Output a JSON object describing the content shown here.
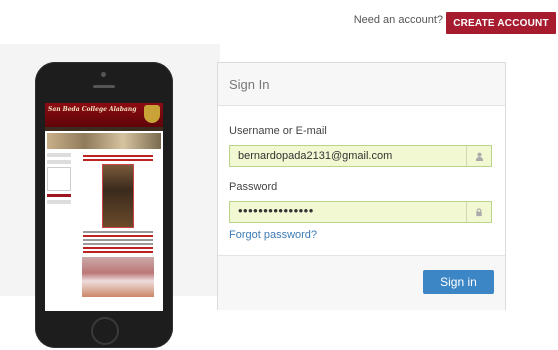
{
  "header": {
    "prompt": "Need an account?",
    "create_account": "CREATE ACCOUNT",
    "accent": "#a61c2e"
  },
  "phone_preview": {
    "site_title": "San Beda College Alabang",
    "screen_description_hidden": ""
  },
  "signin": {
    "title": "Sign In",
    "username_label": "Username or E-mail",
    "username_value": "bernardopada2131@gmail.com",
    "password_label": "Password",
    "password_value": "•••••••••••••••",
    "forgot": "Forgot password?",
    "submit": "Sign in",
    "button_color": "#3d86c6",
    "field_bg": "#f2f8d2"
  },
  "icons": {
    "user": "user-icon",
    "lock": "lock-icon"
  }
}
